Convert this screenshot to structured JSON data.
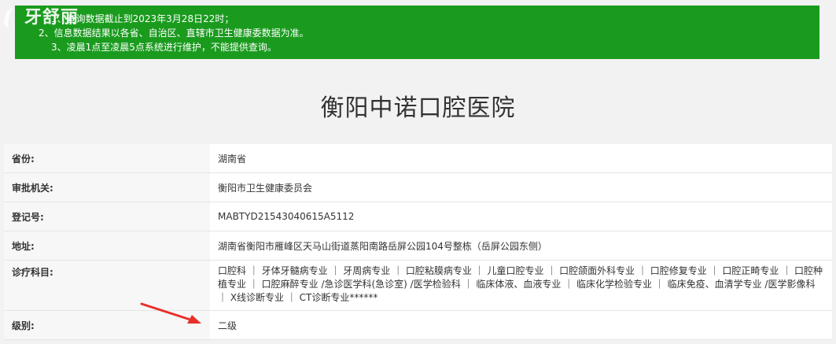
{
  "watermark": {
    "text": "牙舒丽"
  },
  "notice": {
    "lines": [
      "1、查询数据截止到2023年3月28日22时；",
      "2、信息数据结果以各省、自治区、直辖市卫生健康委数据为准。",
      "3、凌晨1点至凌晨5点系统进行维护，不能提供查询。"
    ]
  },
  "title": "衡阳中诺口腔医院",
  "rows": [
    {
      "label": "省份:",
      "value": "湖南省"
    },
    {
      "label": "审批机关:",
      "value": "衡阳市卫生健康委员会"
    },
    {
      "label": "登记号:",
      "value": "MABTYD21543040615A5112"
    },
    {
      "label": "地址:",
      "value": "湖南省衡阳市雁峰区天马山街道蒸阳南路岳屏公园104号整栋（岳屏公园东侧）"
    },
    {
      "label": "诊疗科目:",
      "value": "口腔科 ｜ 牙体牙髓病专业 ｜ 牙周病专业 ｜ 口腔粘膜病专业 ｜ 儿童口腔专业 ｜ 口腔颌面外科专业 ｜ 口腔修复专业 ｜ 口腔正畸专业 ｜ 口腔种植专业 ｜ 口腔麻醉专业 /急诊医学科(急诊室) /医学检验科 ｜ 临床体液、血液专业 ｜ 临床化学检验专业 ｜ 临床免疫、血清学专业 /医学影像科 ｜ X线诊断专业 ｜ CT诊断专业******"
    },
    {
      "label": "级别:",
      "value": "二级"
    }
  ],
  "colors": {
    "notice_bg": "#1a9b1e",
    "arrow": "#e8302a"
  }
}
